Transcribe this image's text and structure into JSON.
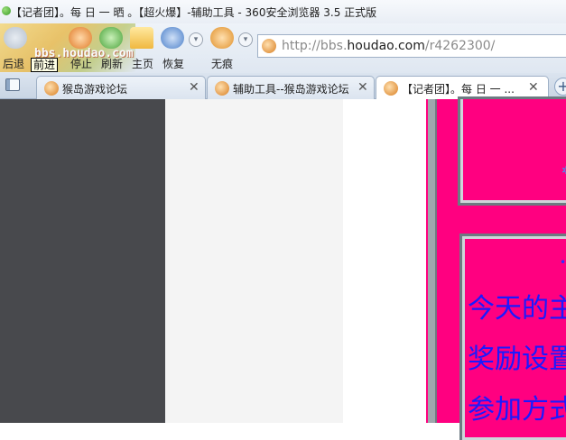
{
  "window": {
    "title": "【记者团】。每 日 一 晒 。【超火爆】-辅助工具 - 360安全浏览器 3.5 正式版"
  },
  "watermark": {
    "text": "bbs.houdao.com"
  },
  "toolbar": {
    "back_label": "后退",
    "forward_label": "前进",
    "stop_label": "停止",
    "refresh_label": "刷新",
    "home_label": "主页",
    "restore_label": "恢复",
    "incognito_label": "无痕",
    "tooltip": "前进"
  },
  "address": {
    "protocol": "http://bbs.",
    "host": "houdao.com",
    "path": "/r4262300/"
  },
  "tabs": [
    {
      "label": "猴岛游戏论坛"
    },
    {
      "label": "辅助工具--猴岛游戏论坛"
    },
    {
      "label": "【记者团】。每 日 一 ..."
    }
  ],
  "page": {
    "line1": "今天的主",
    "line2": "奖励设置",
    "line3": "参加方式",
    "pink_color": "#ff0080",
    "text_color": "#1a1aff"
  }
}
